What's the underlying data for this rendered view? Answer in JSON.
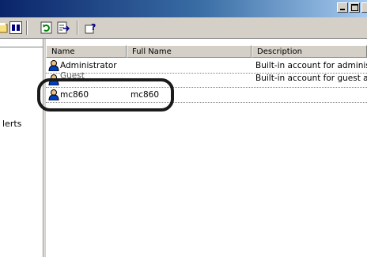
{
  "toolbar": {
    "icons": [
      "properties-icon",
      "detail-view-icon",
      "refresh-icon",
      "export-list-icon",
      "help-icon"
    ]
  },
  "tree": {
    "partial_label": "lerts"
  },
  "columns": [
    "Name",
    "Full Name",
    "Description"
  ],
  "rows": [
    {
      "name": "Administrator",
      "full_name": "",
      "description": "Built-in account for administ"
    },
    {
      "name": "Guest",
      "full_name": "",
      "description": "Built-in account for guest ac"
    },
    {
      "name": "mc860",
      "full_name": "mc860",
      "description": ""
    }
  ],
  "colors": {
    "title_start": "#0a246a",
    "title_end": "#a6caf0",
    "chrome": "#d4d0c8",
    "annotation": "#1a1a1a"
  }
}
